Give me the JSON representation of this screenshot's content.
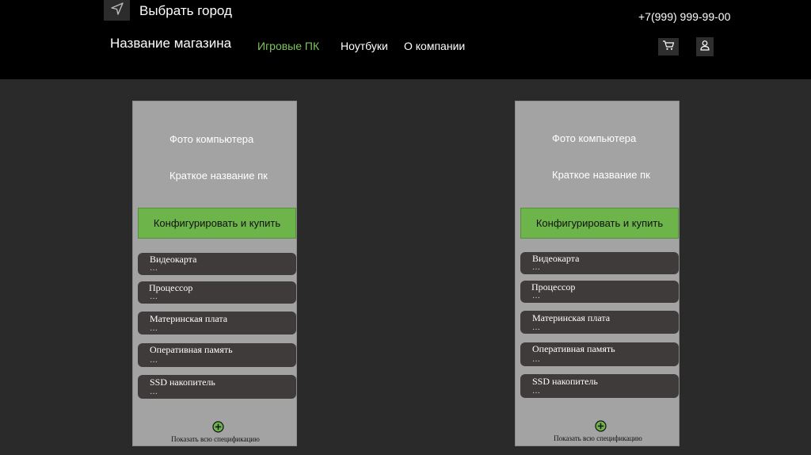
{
  "header": {
    "location_icon": "navigation-arrow-icon",
    "city_label": "Выбрать город",
    "phone": "+7(999) 999-99-00",
    "shop_name": "Название магазина",
    "nav": [
      {
        "label": "Игровые ПК",
        "active": true
      },
      {
        "label": "Ноутбуки",
        "active": false
      },
      {
        "label": "О компании",
        "active": false
      }
    ],
    "cart_icon": "cart-icon",
    "user_icon": "user-icon"
  },
  "colors": {
    "header_bg": "#000000",
    "page_bg": "#2a2a2a",
    "card_bg": "#a3a3a3",
    "accent_green": "#6db44b",
    "nav_active": "#7dc35a",
    "spec_bg": "#3f3b3a"
  },
  "cards": [
    {
      "photo_label": "Фото компьютера",
      "name_label": "Краткое название пк",
      "buy_label": "Конфигурировать и купить",
      "specs": [
        {
          "label": "Видеокарта",
          "value": "…"
        },
        {
          "label": "Процессор",
          "value": "…"
        },
        {
          "label": "Материнская плата",
          "value": "…"
        },
        {
          "label": "Оперативная память",
          "value": "…"
        },
        {
          "label": "SSD накопитель",
          "value": "…"
        }
      ],
      "show_all_icon": "plus-circle-icon",
      "show_all_label": "Показать всю спецификацию"
    },
    {
      "photo_label": "Фото компьютера",
      "name_label": "Краткое название пк",
      "buy_label": "Конфигурировать и купить",
      "specs": [
        {
          "label": "Видеокарта",
          "value": "…"
        },
        {
          "label": "Процессор",
          "value": "…"
        },
        {
          "label": "Материнская плата",
          "value": "…"
        },
        {
          "label": "Оперативная память",
          "value": "…"
        },
        {
          "label": "SSD накопитель",
          "value": "…"
        }
      ],
      "show_all_icon": "plus-circle-icon",
      "show_all_label": "Показать всю спецификацию"
    }
  ]
}
